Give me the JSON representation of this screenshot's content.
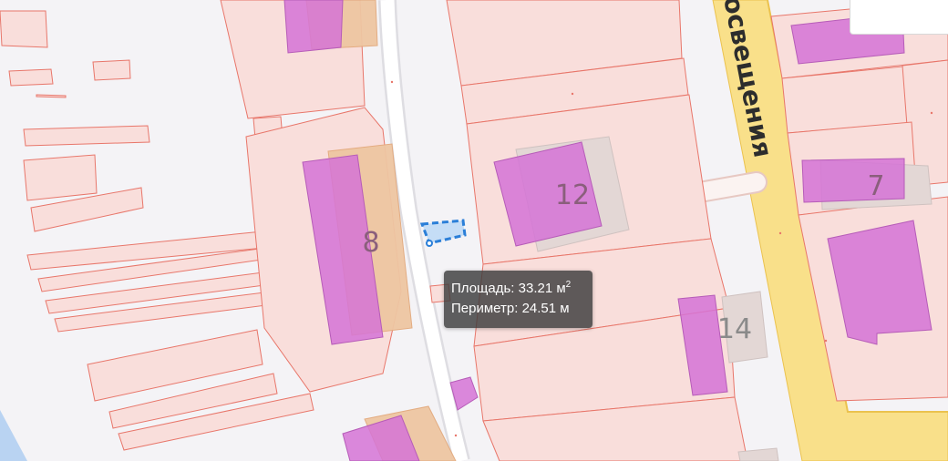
{
  "map": {
    "street_name": "освещения",
    "house_numbers": [
      "12",
      "8",
      "7",
      "14"
    ],
    "measurement": {
      "area_label": "Площадь:",
      "area_value": "33.21 м",
      "area_sup": "2",
      "perimeter_label": "Периметр:",
      "perimeter_value": "24.51 м"
    }
  },
  "colors": {
    "background": "#f4f3f6",
    "parcel_fill": "#f9dedb",
    "parcel_stroke": "#e8766a",
    "building_fill": "#d573d6",
    "orange_block": "#eec6a2",
    "road_yellow": "#f9e08a",
    "road_stroke": "#ebc24e",
    "selection": "#2b7fd8",
    "water": "#b9d3f2"
  }
}
